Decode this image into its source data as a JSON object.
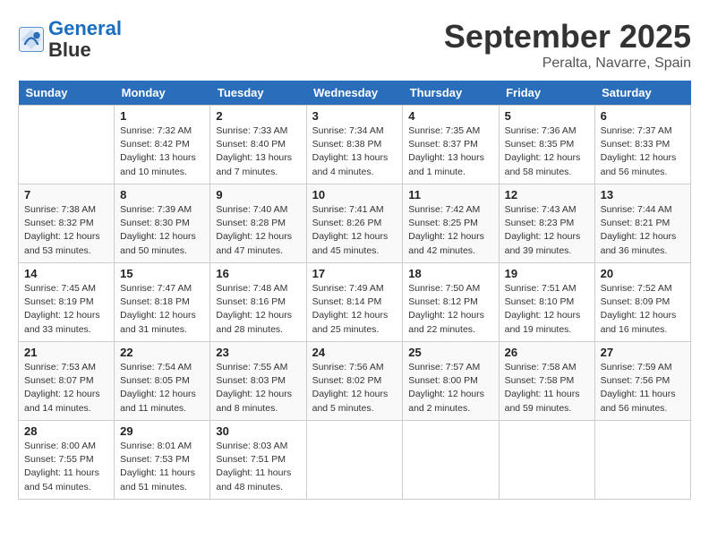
{
  "header": {
    "logo_line1": "General",
    "logo_line2": "Blue",
    "month": "September 2025",
    "location": "Peralta, Navarre, Spain"
  },
  "weekdays": [
    "Sunday",
    "Monday",
    "Tuesday",
    "Wednesday",
    "Thursday",
    "Friday",
    "Saturday"
  ],
  "weeks": [
    [
      {
        "day": "",
        "info": ""
      },
      {
        "day": "1",
        "info": "Sunrise: 7:32 AM\nSunset: 8:42 PM\nDaylight: 13 hours\nand 10 minutes."
      },
      {
        "day": "2",
        "info": "Sunrise: 7:33 AM\nSunset: 8:40 PM\nDaylight: 13 hours\nand 7 minutes."
      },
      {
        "day": "3",
        "info": "Sunrise: 7:34 AM\nSunset: 8:38 PM\nDaylight: 13 hours\nand 4 minutes."
      },
      {
        "day": "4",
        "info": "Sunrise: 7:35 AM\nSunset: 8:37 PM\nDaylight: 13 hours\nand 1 minute."
      },
      {
        "day": "5",
        "info": "Sunrise: 7:36 AM\nSunset: 8:35 PM\nDaylight: 12 hours\nand 58 minutes."
      },
      {
        "day": "6",
        "info": "Sunrise: 7:37 AM\nSunset: 8:33 PM\nDaylight: 12 hours\nand 56 minutes."
      }
    ],
    [
      {
        "day": "7",
        "info": "Sunrise: 7:38 AM\nSunset: 8:32 PM\nDaylight: 12 hours\nand 53 minutes."
      },
      {
        "day": "8",
        "info": "Sunrise: 7:39 AM\nSunset: 8:30 PM\nDaylight: 12 hours\nand 50 minutes."
      },
      {
        "day": "9",
        "info": "Sunrise: 7:40 AM\nSunset: 8:28 PM\nDaylight: 12 hours\nand 47 minutes."
      },
      {
        "day": "10",
        "info": "Sunrise: 7:41 AM\nSunset: 8:26 PM\nDaylight: 12 hours\nand 45 minutes."
      },
      {
        "day": "11",
        "info": "Sunrise: 7:42 AM\nSunset: 8:25 PM\nDaylight: 12 hours\nand 42 minutes."
      },
      {
        "day": "12",
        "info": "Sunrise: 7:43 AM\nSunset: 8:23 PM\nDaylight: 12 hours\nand 39 minutes."
      },
      {
        "day": "13",
        "info": "Sunrise: 7:44 AM\nSunset: 8:21 PM\nDaylight: 12 hours\nand 36 minutes."
      }
    ],
    [
      {
        "day": "14",
        "info": "Sunrise: 7:45 AM\nSunset: 8:19 PM\nDaylight: 12 hours\nand 33 minutes."
      },
      {
        "day": "15",
        "info": "Sunrise: 7:47 AM\nSunset: 8:18 PM\nDaylight: 12 hours\nand 31 minutes."
      },
      {
        "day": "16",
        "info": "Sunrise: 7:48 AM\nSunset: 8:16 PM\nDaylight: 12 hours\nand 28 minutes."
      },
      {
        "day": "17",
        "info": "Sunrise: 7:49 AM\nSunset: 8:14 PM\nDaylight: 12 hours\nand 25 minutes."
      },
      {
        "day": "18",
        "info": "Sunrise: 7:50 AM\nSunset: 8:12 PM\nDaylight: 12 hours\nand 22 minutes."
      },
      {
        "day": "19",
        "info": "Sunrise: 7:51 AM\nSunset: 8:10 PM\nDaylight: 12 hours\nand 19 minutes."
      },
      {
        "day": "20",
        "info": "Sunrise: 7:52 AM\nSunset: 8:09 PM\nDaylight: 12 hours\nand 16 minutes."
      }
    ],
    [
      {
        "day": "21",
        "info": "Sunrise: 7:53 AM\nSunset: 8:07 PM\nDaylight: 12 hours\nand 14 minutes."
      },
      {
        "day": "22",
        "info": "Sunrise: 7:54 AM\nSunset: 8:05 PM\nDaylight: 12 hours\nand 11 minutes."
      },
      {
        "day": "23",
        "info": "Sunrise: 7:55 AM\nSunset: 8:03 PM\nDaylight: 12 hours\nand 8 minutes."
      },
      {
        "day": "24",
        "info": "Sunrise: 7:56 AM\nSunset: 8:02 PM\nDaylight: 12 hours\nand 5 minutes."
      },
      {
        "day": "25",
        "info": "Sunrise: 7:57 AM\nSunset: 8:00 PM\nDaylight: 12 hours\nand 2 minutes."
      },
      {
        "day": "26",
        "info": "Sunrise: 7:58 AM\nSunset: 7:58 PM\nDaylight: 11 hours\nand 59 minutes."
      },
      {
        "day": "27",
        "info": "Sunrise: 7:59 AM\nSunset: 7:56 PM\nDaylight: 11 hours\nand 56 minutes."
      }
    ],
    [
      {
        "day": "28",
        "info": "Sunrise: 8:00 AM\nSunset: 7:55 PM\nDaylight: 11 hours\nand 54 minutes."
      },
      {
        "day": "29",
        "info": "Sunrise: 8:01 AM\nSunset: 7:53 PM\nDaylight: 11 hours\nand 51 minutes."
      },
      {
        "day": "30",
        "info": "Sunrise: 8:03 AM\nSunset: 7:51 PM\nDaylight: 11 hours\nand 48 minutes."
      },
      {
        "day": "",
        "info": ""
      },
      {
        "day": "",
        "info": ""
      },
      {
        "day": "",
        "info": ""
      },
      {
        "day": "",
        "info": ""
      }
    ]
  ]
}
